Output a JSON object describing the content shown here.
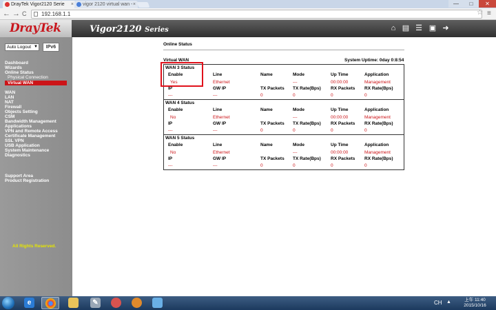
{
  "browser": {
    "tabs": [
      {
        "label": "DrayTek Vigor2120 Serie",
        "active": true
      },
      {
        "label": "vigor 2120 virtual wan -",
        "active": false
      }
    ],
    "url": "192.168.1.1",
    "back_label": "←",
    "forward_label": "→",
    "reload_label": "C",
    "window_min": "—",
    "window_max": "□",
    "window_close": "✕"
  },
  "header": {
    "logo": "DrayTek",
    "model": "Vigor2120",
    "series": "Series",
    "icons": [
      "home-icon",
      "quick-start-icon",
      "list-icon",
      "save-icon",
      "logout-icon"
    ]
  },
  "sidebar": {
    "auto_logout": "Auto Logout",
    "ipv6_label": "IPv6",
    "items": [
      {
        "label": "Dashboard"
      },
      {
        "label": "Wizards"
      },
      {
        "label": "Online Status"
      },
      {
        "label": "Physical Connection",
        "sub": true
      },
      {
        "label": "Virtual WAN",
        "sub": true,
        "active": true
      },
      {
        "label": "WAN"
      },
      {
        "label": "LAN"
      },
      {
        "label": "NAT"
      },
      {
        "label": "Firewall"
      },
      {
        "label": "Objects Setting"
      },
      {
        "label": "CSM"
      },
      {
        "label": "Bandwidth Management"
      },
      {
        "label": "Applications"
      },
      {
        "label": "VPN and Remote Access"
      },
      {
        "label": "Certificate Management"
      },
      {
        "label": "SSL VPN"
      },
      {
        "label": "USB Application"
      },
      {
        "label": "System Maintenance"
      },
      {
        "label": "Diagnostics"
      },
      {
        "label": "Support Area"
      },
      {
        "label": "Product Registration"
      }
    ],
    "footer": "All Rights Reserved."
  },
  "main": {
    "title": "Online Status",
    "section_label": "Virtual WAN",
    "uptime": "System Uptime: 0day 0:8:54",
    "header_row1": [
      "Enable",
      "Line",
      "Name",
      "Mode",
      "Up Time",
      "Application"
    ],
    "header_row2": [
      "IP",
      "GW IP",
      "TX Packets",
      "TX Rate(Bps)",
      "RX Packets",
      "RX Rate(Bps)"
    ],
    "wans": [
      {
        "title": "WAN 3 Status",
        "row1": [
          "Yes",
          "Ethernet",
          "",
          "---",
          "00:00:00",
          "Management"
        ],
        "row2": [
          "---",
          "---",
          "0",
          "0",
          "0",
          "0"
        ]
      },
      {
        "title": "WAN 4 Status",
        "row1": [
          "No",
          "Ethernet",
          "",
          "---",
          "00:00:00",
          "Management"
        ],
        "row2": [
          "---",
          "---",
          "0",
          "0",
          "0",
          "0"
        ]
      },
      {
        "title": "WAN 5 Status",
        "row1": [
          "No",
          "Ethernet",
          "",
          "---",
          "00:00:00",
          "Management"
        ],
        "row2": [
          "---",
          "---",
          "0",
          "0",
          "0",
          "0"
        ]
      }
    ]
  },
  "taskbar": {
    "apps": [
      "ie-icon",
      "chrome-icon",
      "explorer-icon",
      "tool-icon",
      "app-icon",
      "app2-icon",
      "app3-icon"
    ],
    "lang": "CH",
    "time": "上午 11:40",
    "date": "2015/10/16"
  },
  "colors": {
    "accent_red": "#cc1418",
    "header_dark": "#303030",
    "sidebar_gray": "#9a9a9a",
    "taskbar_blue": "#1c3a5e"
  }
}
